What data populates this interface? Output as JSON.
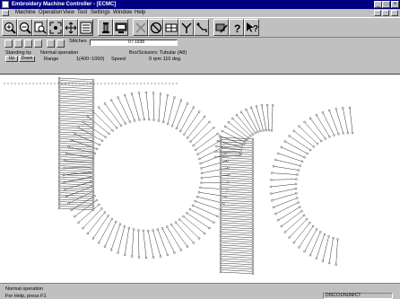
{
  "window": {
    "title": "Embroidery Machine Controller - [ECMC]",
    "controls": [
      "_",
      "□",
      "×"
    ]
  },
  "menu": [
    "Machine",
    "Operation",
    "View",
    "Tool",
    "Settings",
    "Window",
    "Help"
  ],
  "toolbar": {
    "buttons": [
      "zoom-in-icon",
      "zoom-out-icon",
      "zoom-window-icon",
      "fit-icon",
      "expand-icon",
      "stitch-list-icon",
      "spool-icon",
      "monitor-icon",
      "close-icon",
      "cancel-icon",
      "panel-icon",
      "fork-icon",
      "needle-icon",
      "monitor-pen-icon",
      "help-icon",
      "context-help-icon"
    ]
  },
  "info": {
    "stitches_label": "Stitches",
    "stitches_value": "0 / 1938",
    "status_label": "Standing by",
    "operation": "Normal operation",
    "up_label": "Up",
    "down_label": "Down",
    "range_label": "Range",
    "range_value": "1(400~1000)",
    "speed_label": "Speed",
    "frame_label": "Bro/Scissors: Tubular (A8)",
    "speed_value": "0 rpm 110 deg."
  },
  "status": {
    "line1": "Normal operation",
    "line2": "For Help, press F1",
    "pane": "DISCO1/NUM/CT"
  }
}
